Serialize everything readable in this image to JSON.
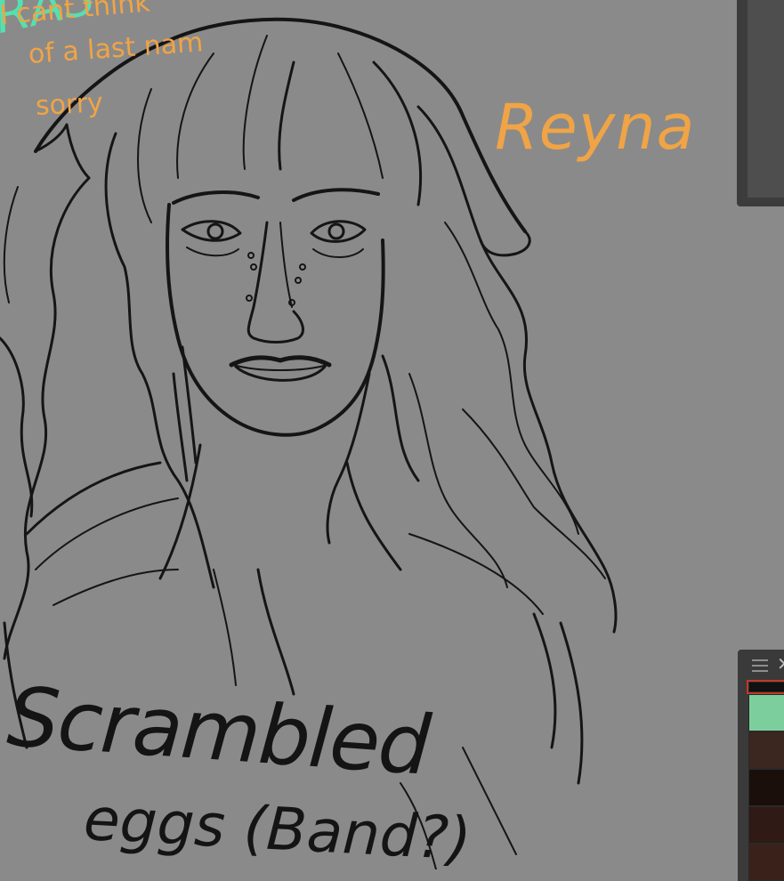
{
  "canvas": {
    "background": "#8a8a8a",
    "annotations": {
      "name": "Reyna",
      "note_lines": [
        "I cant think",
        "of a last nam",
        "sorry"
      ],
      "corner_text": "RAS",
      "caption_line1": "Scrambled",
      "caption_line2": "eggs (Band?)"
    },
    "colors": {
      "name_ink": "#f0a446",
      "corner_ink": "#55e0b0",
      "line_ink": "#141414"
    }
  },
  "swatch_panel": {
    "menu_icon": "hamburger-icon",
    "close_icon": "close-icon",
    "close_glyph": "✕",
    "swatches": [
      "#111111",
      "#7ccf9d",
      "#3c2620",
      "#1a0f0b",
      "#2f1a15",
      "#3a221b"
    ]
  }
}
